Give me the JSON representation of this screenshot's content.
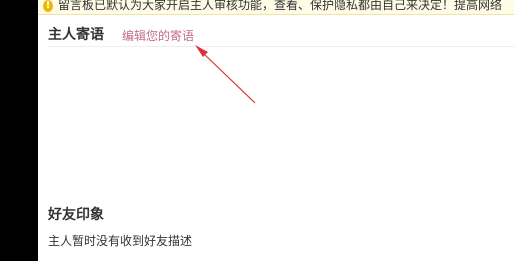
{
  "notice": {
    "icon": "warning-icon",
    "text": "留言板已默认为大家开启主人审核功能，查看、保护隐私都由自己来决定！提高网络"
  },
  "host_message": {
    "title": "主人寄语",
    "edit_link": "编辑您的寄语"
  },
  "friend_impression": {
    "title": "好友印象",
    "empty_text": "主人暂时没有收到好友描述"
  },
  "colors": {
    "link": "#c36b8c",
    "annotation_arrow": "#e0303a",
    "notice_bg": "#fffbe6"
  }
}
